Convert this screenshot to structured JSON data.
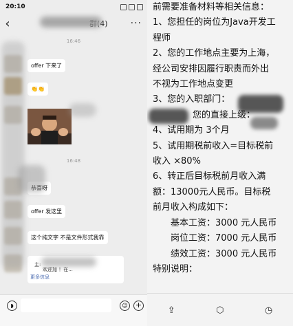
{
  "chat": {
    "status_time": "20:10",
    "status_icons": [
      "signal-icon",
      "wifi-icon",
      "battery-icon"
    ],
    "title": "群(4)",
    "timestamps": [
      "16:46",
      "16:48"
    ],
    "messages": [
      "offer 下来了",
      "👏👏",
      "恭喜呀",
      "offer 发这里",
      "这个纯文字 不是文件形式我靠"
    ],
    "link_card": {
      "line1": "主:",
      "line2": "欢迎加                    ！在...",
      "more": "更多信息"
    }
  },
  "doc": {
    "lines": [
      "前需要准备材料等相关信息：",
      "1、您担任的岗位为Java开发工",
      "程师",
      "2、您的工作地点主要为上海，",
      "经公司安排因履行职责而外出",
      "不视为工作地点变更",
      "3、您的入职部门：",
      "您的直接上级：",
      "4、试用期为 3个月",
      "5、试用期税前收入=目标税前",
      "收入 ×80%",
      "6、转正后目标税前月收入满",
      "额：13000元人民币。目标税",
      "前月收入构成如下：",
      "基本工资：3000 元人民币",
      "岗位工资：7000 元人民币",
      "绩效工资：3000 元人民币",
      "特别说明："
    ]
  }
}
